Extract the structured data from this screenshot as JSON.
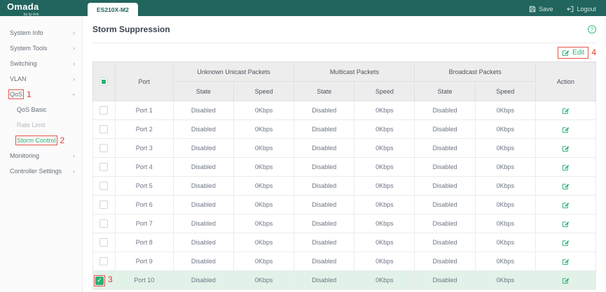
{
  "topbar": {
    "brand": "Omada",
    "brand_sub": "by tp-link",
    "tab": "ES210X-M2",
    "save_label": "Save",
    "logout_label": "Logout"
  },
  "sidebar": {
    "items": [
      {
        "label": "System Info",
        "chevron": "right"
      },
      {
        "label": "System Tools",
        "chevron": "right"
      },
      {
        "label": "Switching",
        "chevron": "right"
      },
      {
        "label": "VLAN",
        "chevron": "right"
      },
      {
        "label": "QoS",
        "chevron": "down",
        "boxed": true,
        "annotation": "1"
      },
      {
        "label": "QoS Basic",
        "sub": true
      },
      {
        "label": "Rate Limit",
        "sub": true,
        "muted": true
      },
      {
        "label": "Storm Control",
        "sub": true,
        "active": true,
        "boxed": true,
        "annotation": "2"
      },
      {
        "label": "Monitoring",
        "chevron": "right"
      },
      {
        "label": "Controller Settings",
        "chevron": "right"
      }
    ]
  },
  "page": {
    "title": "Storm Suppression",
    "help_glyph": "?"
  },
  "toolbar": {
    "edit_label": "Edit",
    "annotation": "4"
  },
  "table": {
    "select_all_state": "partial",
    "port_header": "Port",
    "groups": [
      "Unknown Unicast Packets",
      "Multicast Packets",
      "Broadcast Packets"
    ],
    "state_header": "State",
    "speed_header": "Speed",
    "action_header": "Action",
    "selected_annotation": "3",
    "rows": [
      {
        "port": "Port 1",
        "unknown_unicast": {
          "state": "Disabled",
          "speed": "0Kbps"
        },
        "multicast": {
          "state": "Disabled",
          "speed": "0Kbps"
        },
        "broadcast": {
          "state": "Disabled",
          "speed": "0Kbps"
        },
        "selected": false
      },
      {
        "port": "Port 2",
        "unknown_unicast": {
          "state": "Disabled",
          "speed": "0Kbps"
        },
        "multicast": {
          "state": "Disabled",
          "speed": "0Kbps"
        },
        "broadcast": {
          "state": "Disabled",
          "speed": "0Kbps"
        },
        "selected": false
      },
      {
        "port": "Port 3",
        "unknown_unicast": {
          "state": "Disabled",
          "speed": "0Kbps"
        },
        "multicast": {
          "state": "Disabled",
          "speed": "0Kbps"
        },
        "broadcast": {
          "state": "Disabled",
          "speed": "0Kbps"
        },
        "selected": false
      },
      {
        "port": "Port 4",
        "unknown_unicast": {
          "state": "Disabled",
          "speed": "0Kbps"
        },
        "multicast": {
          "state": "Disabled",
          "speed": "0Kbps"
        },
        "broadcast": {
          "state": "Disabled",
          "speed": "0Kbps"
        },
        "selected": false
      },
      {
        "port": "Port 5",
        "unknown_unicast": {
          "state": "Disabled",
          "speed": "0Kbps"
        },
        "multicast": {
          "state": "Disabled",
          "speed": "0Kbps"
        },
        "broadcast": {
          "state": "Disabled",
          "speed": "0Kbps"
        },
        "selected": false
      },
      {
        "port": "Port 6",
        "unknown_unicast": {
          "state": "Disabled",
          "speed": "0Kbps"
        },
        "multicast": {
          "state": "Disabled",
          "speed": "0Kbps"
        },
        "broadcast": {
          "state": "Disabled",
          "speed": "0Kbps"
        },
        "selected": false
      },
      {
        "port": "Port 7",
        "unknown_unicast": {
          "state": "Disabled",
          "speed": "0Kbps"
        },
        "multicast": {
          "state": "Disabled",
          "speed": "0Kbps"
        },
        "broadcast": {
          "state": "Disabled",
          "speed": "0Kbps"
        },
        "selected": false
      },
      {
        "port": "Port 8",
        "unknown_unicast": {
          "state": "Disabled",
          "speed": "0Kbps"
        },
        "multicast": {
          "state": "Disabled",
          "speed": "0Kbps"
        },
        "broadcast": {
          "state": "Disabled",
          "speed": "0Kbps"
        },
        "selected": false
      },
      {
        "port": "Port 9",
        "unknown_unicast": {
          "state": "Disabled",
          "speed": "0Kbps"
        },
        "multicast": {
          "state": "Disabled",
          "speed": "0Kbps"
        },
        "broadcast": {
          "state": "Disabled",
          "speed": "0Kbps"
        },
        "selected": false
      },
      {
        "port": "Port 10",
        "unknown_unicast": {
          "state": "Disabled",
          "speed": "0Kbps"
        },
        "multicast": {
          "state": "Disabled",
          "speed": "0Kbps"
        },
        "broadcast": {
          "state": "Disabled",
          "speed": "0Kbps"
        },
        "selected": true
      }
    ]
  },
  "colors": {
    "topbar_teal": "#21655e",
    "accent_green": "#2cb277",
    "selected_row_bg": "#e3f2e9",
    "annotation_red": "#e2382e",
    "header_bg": "#ededed"
  }
}
